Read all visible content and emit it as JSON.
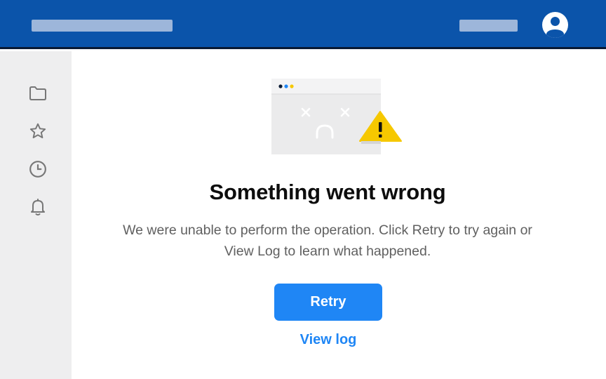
{
  "header": {
    "avatar_icon": "user-avatar-icon",
    "background_color": "#0b54aa"
  },
  "sidebar": {
    "items": [
      {
        "icon": "folder-icon"
      },
      {
        "icon": "star-icon"
      },
      {
        "icon": "clock-icon"
      },
      {
        "icon": "bell-icon"
      }
    ]
  },
  "error": {
    "illustration_icon": "broken-window-warning-icon",
    "title": "Something went wrong",
    "message": "We were unable to perform the operation. Click Retry to try again or View Log to learn what happened.",
    "retry_label": "Retry",
    "view_log_label": "View log",
    "accent_color": "#1f86f5",
    "warning_color": "#f6c800"
  }
}
